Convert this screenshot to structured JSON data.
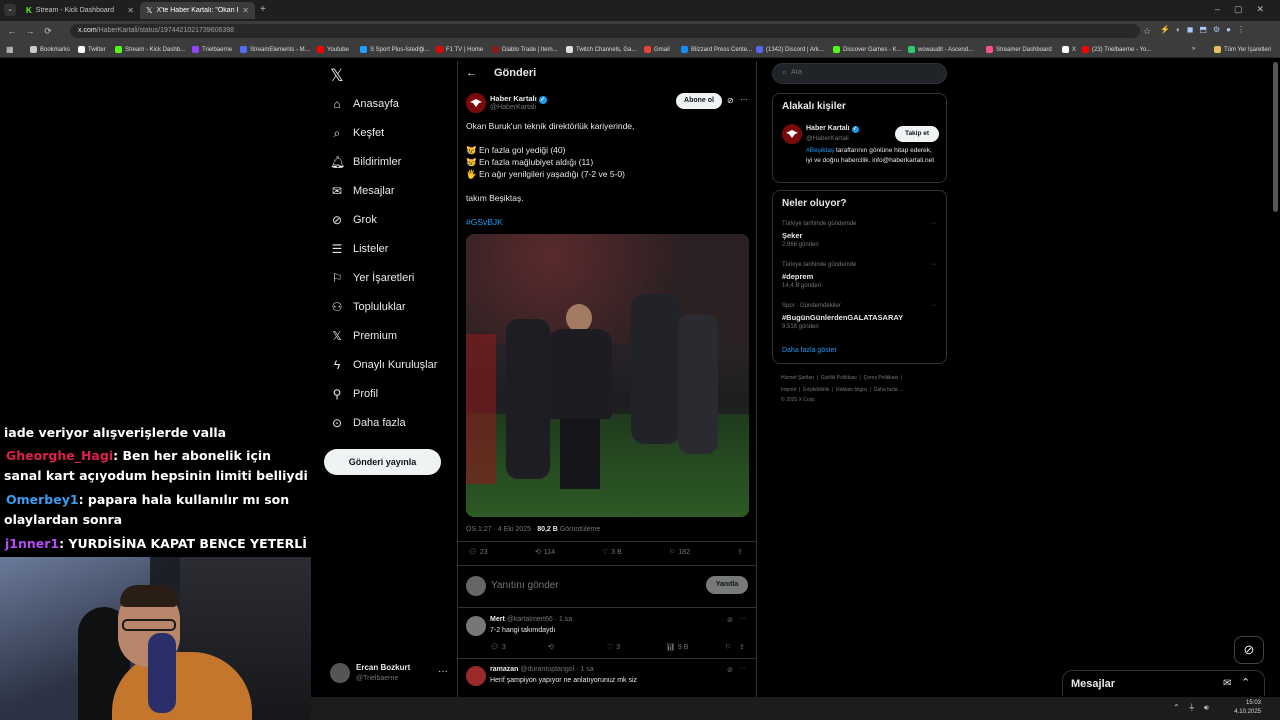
{
  "browser": {
    "tabs": [
      {
        "title": "Stream - Kick Dashboard",
        "active": false
      },
      {
        "title": "X'te Haber Kartalı: \"Okan Buruk",
        "active": true
      }
    ],
    "url_host": "x.com",
    "url_path": "/HaberKartali/status/1974421021739606398",
    "bookmarks": [
      "Bookmarks",
      "Twitter",
      "Stream - Kick Dashb...",
      "Trielbaerne",
      "StreamElements - M...",
      "Youtube",
      "S Sport Plus-İstediği...",
      "F1 TV | Home",
      "Diablo Trade | Item...",
      "Twitch Channels, Ga...",
      "Gmail",
      "Blizzard Press Cente...",
      "(1342) Discord | Ark...",
      "Discover Games - K...",
      "wowaudit - Ascend...",
      "Streamer Dashboard",
      "X",
      "(23) Trielbaerne - Yo..."
    ],
    "all_bookmarks": "Tüm Yer İşaretleri"
  },
  "stream_chat": {
    "lines": [
      {
        "user": "",
        "user_color": "#ffffff",
        "text": "iade veriyor alışverişlerde valla"
      },
      {
        "user": "Gheorghe_Hagi",
        "user_color": "#e0204a",
        "text": ": Ben her abonelik için sanal kart açıyodum hepsinin limiti belliydi"
      },
      {
        "user": "Omerbey1",
        "user_color": "#3b9cf0",
        "text": ": papara hala kullanılır mı son olaylardan sonra"
      },
      {
        "user": "j1nner1",
        "user_color": "#b54cf5",
        "text": ": YURDİSİNA KAPAT BENCE YETERLİ"
      }
    ]
  },
  "nav": {
    "items": [
      {
        "label": "Anasayfa",
        "icon": "home-icon"
      },
      {
        "label": "Keşfet",
        "icon": "search-icon"
      },
      {
        "label": "Bildirimler",
        "icon": "bell-icon"
      },
      {
        "label": "Mesajlar",
        "icon": "mail-icon"
      },
      {
        "label": "Grok",
        "icon": "grok-icon"
      },
      {
        "label": "Listeler",
        "icon": "list-icon"
      },
      {
        "label": "Yer İşaretleri",
        "icon": "bookmark-icon"
      },
      {
        "label": "Topluluklar",
        "icon": "communities-icon"
      },
      {
        "label": "Premium",
        "icon": "x-logo-icon"
      },
      {
        "label": "Onaylı Kuruluşlar",
        "icon": "lightning-icon"
      },
      {
        "label": "Profil",
        "icon": "person-icon"
      },
      {
        "label": "Daha fazla",
        "icon": "more-circle-icon"
      }
    ],
    "post_button": "Gönderi yayınla",
    "account": {
      "name": "Ercan Bozkurt",
      "handle": "@Trielbaerne"
    }
  },
  "post": {
    "header_title": "Gönderi",
    "author_name": "Haber Kartalı",
    "author_handle": "@HaberKartali",
    "subscribe_label": "Abone ol",
    "text_line1": "Okan Buruk'un teknik direktörlük kariyerinde,",
    "bullets": [
      {
        "emoji": "😿",
        "text": "En fazla gol yediği (40)"
      },
      {
        "emoji": "😿",
        "text": "En fazla mağlubiyet aldığı (11)"
      },
      {
        "emoji": "🖐",
        "text": "En ağır yenilgileri yaşadığı (7-2 ve 5-0)"
      }
    ],
    "text_line2": "takım Beşiktaş.",
    "hashtag": "#GSvBJK",
    "time": "ÖS 1:27 · 4 Eki 2025 · ",
    "views_count": "80,2 B",
    "views_label": " Görüntüleme",
    "stats": {
      "replies": "23",
      "reposts": "114",
      "likes": "3 B",
      "bookmarks": "182"
    },
    "reply_placeholder": "Yanıtını gönder",
    "reply_button": "Yanıtla"
  },
  "replies": [
    {
      "name": "Mert",
      "handle": "@kartalmert66 · 1 sa",
      "text": "7-2 hangi takımdaydı",
      "replies": "3",
      "reposts": "",
      "likes": "3",
      "views": "9 B"
    },
    {
      "name": "ramazan",
      "handle": "@durantoptangol · 1 sa",
      "text": "Herif şampiyon yapıyor ne anlatıyorunuz mk siz",
      "replies": "",
      "reposts": "",
      "likes": "",
      "views": ""
    }
  ],
  "right": {
    "search_placeholder": "Ara",
    "related_title": "Alakalı kişiler",
    "related": {
      "name": "Haber Kartalı",
      "handle": "@HaberKartali",
      "follow": "Takip et",
      "bio_tag": "#Beşiktaş",
      "bio": " taraftarının gönlüne hitap ederek, iyi ve doğru habercilik. info@haberkartali.net"
    },
    "trends_title": "Neler oluyor?",
    "trends": [
      {
        "context": "Türkiye tarihinde gündemde",
        "name": "Şeker",
        "count": "2.966 gönderi"
      },
      {
        "context": "Türkiye tarihinde gündemde",
        "name": "#deprem",
        "count": "14,4 B gönderi"
      },
      {
        "context": "Spor · Gündemdekiler",
        "name": "#BugünGünlerdenGALATASARAY",
        "count": "9.518 gönderi"
      }
    ],
    "show_more": "Daha fazla göster",
    "footer_line1": "Hizmet Şartları  |  Gizlilik Politikası  |  Çerez Politikası  |",
    "footer_line2": "Imprint  |  Erişilebilirlik  |  Reklam bilgisi  |  Daha fazla ...",
    "footer_line3": "© 2025 X Corp."
  },
  "messages_bar": {
    "label": "Mesajlar"
  },
  "taskbar": {
    "time": "15:03",
    "date": "4.10.2025"
  }
}
